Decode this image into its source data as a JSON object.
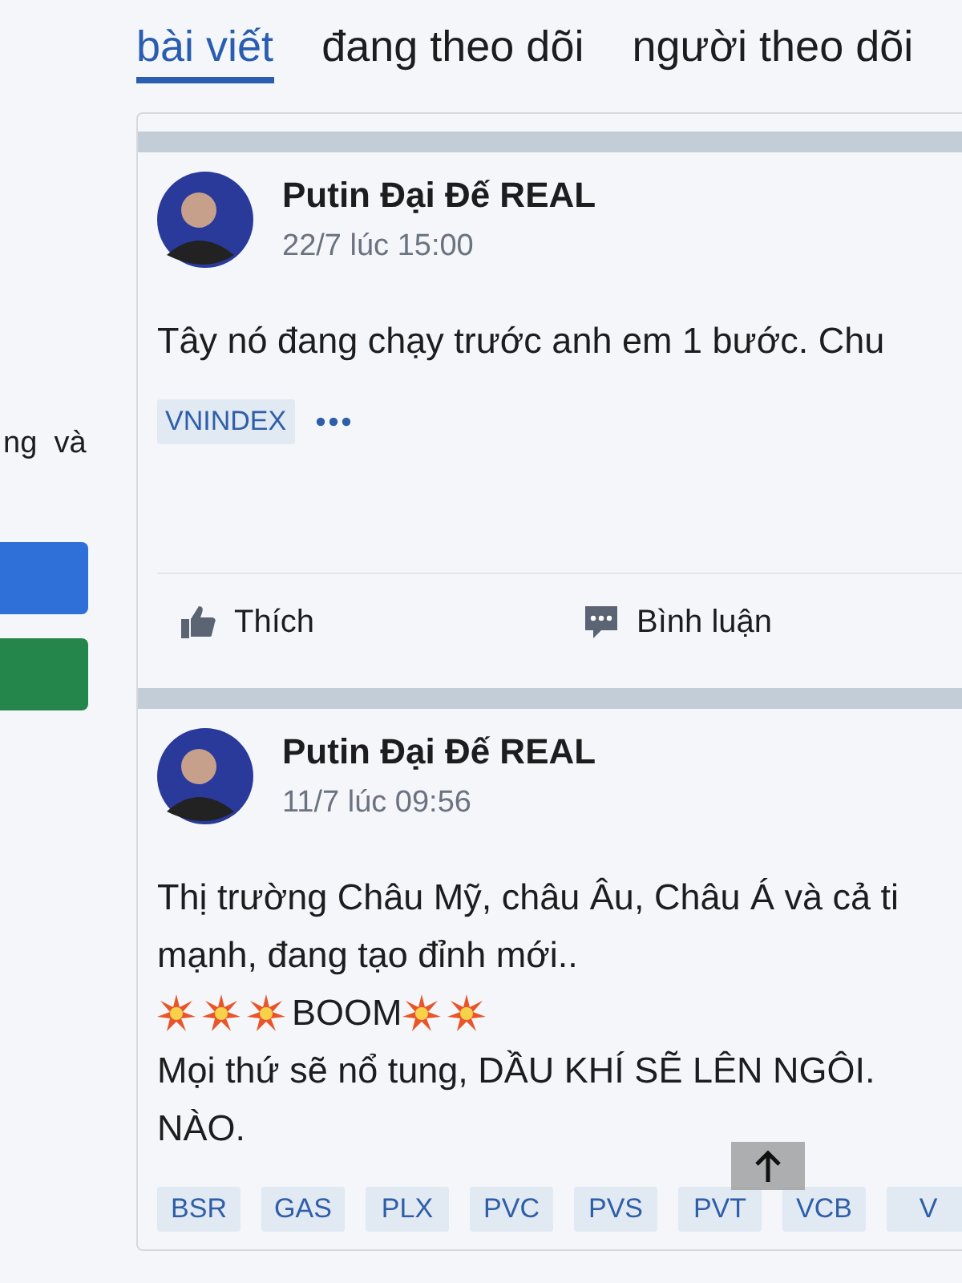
{
  "side": {
    "text": "ng  và",
    "buttons": [
      {
        "color": "#2f6fd8"
      },
      {
        "color": "#24864a"
      }
    ]
  },
  "tabs": [
    {
      "label": "bài viết",
      "selected": true
    },
    {
      "label": "đang theo dõi",
      "selected": false
    },
    {
      "label": "người theo dõi",
      "selected": false
    }
  ],
  "posts": [
    {
      "author": "Putin Đại Đế REAL",
      "time": "22/7 lúc 15:00",
      "lines": [
        [
          {
            "kind": "text",
            "text": "Tây nó đang chạy trước anh em 1 bước. Chu"
          }
        ]
      ],
      "tags": [
        "VNINDEX"
      ],
      "more": true,
      "actions": [
        "Thích",
        "Bình luận"
      ]
    },
    {
      "author": "Putin Đại Đế REAL",
      "time": "11/7 lúc 09:56",
      "lines": [
        [
          {
            "kind": "text",
            "text": "Thị trường Châu Mỹ, châu Âu, Châu Á và cả ti"
          }
        ],
        [
          {
            "kind": "text",
            "text": "mạnh, đang tạo đỉnh mới.."
          }
        ],
        [
          {
            "kind": "burst"
          },
          {
            "kind": "burst"
          },
          {
            "kind": "burst"
          },
          {
            "kind": "text",
            "text": "BOOM"
          },
          {
            "kind": "burst"
          },
          {
            "kind": "burst"
          }
        ],
        [
          {
            "kind": "text",
            "text": "Mọi thứ sẽ nổ tung, DẦU KHÍ SẼ LÊN NGÔI."
          }
        ],
        [
          {
            "kind": "text",
            "text": "NÀO."
          }
        ]
      ],
      "tags": [
        "BSR",
        "GAS",
        "PLX",
        "PVC",
        "PVS",
        "PVT",
        "VCB",
        "V"
      ]
    }
  ]
}
